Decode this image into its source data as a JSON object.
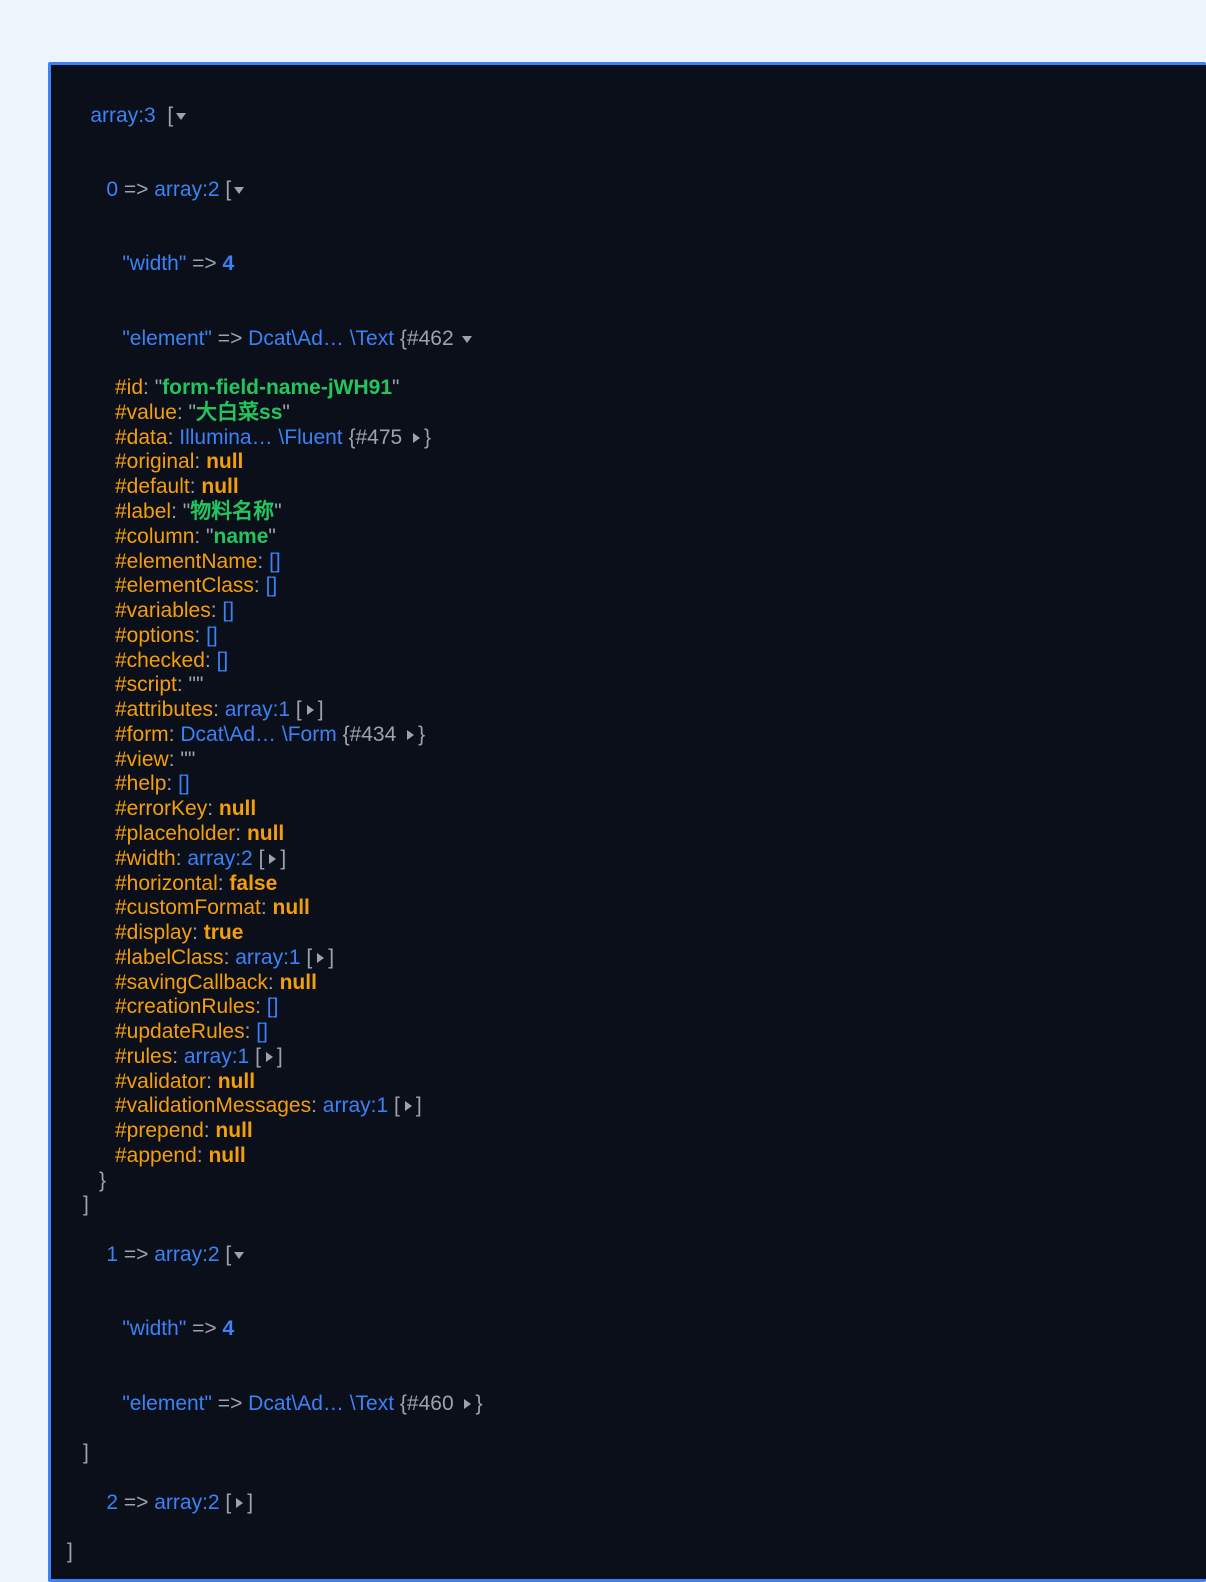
{
  "root": {
    "label": "array:3",
    "open_br": "[",
    "close_br": "]"
  },
  "item0": {
    "key": "0",
    "arrow": " => ",
    "type": "array:2",
    "open": " [",
    "close": "]",
    "width_key": "\"width\"",
    "width_arrow": " => ",
    "width_val": "4",
    "element_key": "\"element\"",
    "element_arrow": " => ",
    "element_class": "Dcat\\Ad… \\Text ",
    "element_hash": "{#462 ",
    "element_close": "}"
  },
  "props": {
    "id": {
      "k": "#id",
      "sep": ": \"",
      "v": "form-field-name-jWH91",
      "tail": "\""
    },
    "value": {
      "k": "#value",
      "sep": ": \"",
      "v": "大白菜ss",
      "tail": "\""
    },
    "data": {
      "k": "#data",
      "sep": ": ",
      "cls": "Illumina… \\Fluent ",
      "hash": "{#475 ",
      "tail": "}"
    },
    "original": {
      "k": "#original",
      "sep": ": ",
      "v": "null"
    },
    "default": {
      "k": "#default",
      "sep": ": ",
      "v": "null"
    },
    "label": {
      "k": "#label",
      "sep": ": \"",
      "v": "物料名称",
      "tail": "\""
    },
    "column": {
      "k": "#column",
      "sep": ": \"",
      "v": "name",
      "tail": "\""
    },
    "elementName": {
      "k": "#elementName",
      "sep": ": ",
      "v": "[]"
    },
    "elementClass": {
      "k": "#elementClass",
      "sep": ": ",
      "v": "[]"
    },
    "variables": {
      "k": "#variables",
      "sep": ": ",
      "v": "[]"
    },
    "options": {
      "k": "#options",
      "sep": ": ",
      "v": "[]"
    },
    "checked": {
      "k": "#checked",
      "sep": ": ",
      "v": "[]"
    },
    "script": {
      "k": "#script",
      "sep": ": ",
      "v": "\"\""
    },
    "attributes": {
      "k": "#attributes",
      "sep": ": ",
      "cls": "array:1",
      "open": " [",
      "close": "]"
    },
    "form": {
      "k": "#form",
      "sep": ": ",
      "cls": "Dcat\\Ad… \\Form ",
      "hash": "{#434 ",
      "tail": "}"
    },
    "view": {
      "k": "#view",
      "sep": ": ",
      "v": "\"\""
    },
    "help": {
      "k": "#help",
      "sep": ": ",
      "v": "[]"
    },
    "errorKey": {
      "k": "#errorKey",
      "sep": ": ",
      "v": "null"
    },
    "placeholder": {
      "k": "#placeholder",
      "sep": ": ",
      "v": "null"
    },
    "width": {
      "k": "#width",
      "sep": ": ",
      "cls": "array:2",
      "open": " [",
      "close": "]"
    },
    "horizontal": {
      "k": "#horizontal",
      "sep": ": ",
      "v": "false"
    },
    "customFormat": {
      "k": "#customFormat",
      "sep": ": ",
      "v": "null"
    },
    "display": {
      "k": "#display",
      "sep": ": ",
      "v": "true"
    },
    "labelClass": {
      "k": "#labelClass",
      "sep": ": ",
      "cls": "array:1",
      "open": " [",
      "close": "]"
    },
    "savingCallback": {
      "k": "#savingCallback",
      "sep": ": ",
      "v": "null"
    },
    "creationRules": {
      "k": "#creationRules",
      "sep": ": ",
      "v": "[]"
    },
    "updateRules": {
      "k": "#updateRules",
      "sep": ": ",
      "v": "[]"
    },
    "rules": {
      "k": "#rules",
      "sep": ": ",
      "cls": "array:1",
      "open": " [",
      "close": "]"
    },
    "validator": {
      "k": "#validator",
      "sep": ": ",
      "v": "null"
    },
    "validationMessages": {
      "k": "#validationMessages",
      "sep": ": ",
      "cls": "array:1",
      "open": " [",
      "close": "]"
    },
    "prepend": {
      "k": "#prepend",
      "sep": ": ",
      "v": "null"
    },
    "append": {
      "k": "#append",
      "sep": ": ",
      "v": "null"
    }
  },
  "item1": {
    "key": "1",
    "arrow": " => ",
    "type": "array:2",
    "open": " [",
    "close": "]",
    "width_key": "\"width\"",
    "width_arrow": " => ",
    "width_val": "4",
    "element_key": "\"element\"",
    "element_arrow": " => ",
    "element_class": "Dcat\\Ad… \\Text ",
    "element_hash": "{#460 ",
    "element_tail": "}"
  },
  "item2": {
    "key": "2",
    "arrow": " => ",
    "type": "array:2",
    "open": " [",
    "close": "]"
  }
}
